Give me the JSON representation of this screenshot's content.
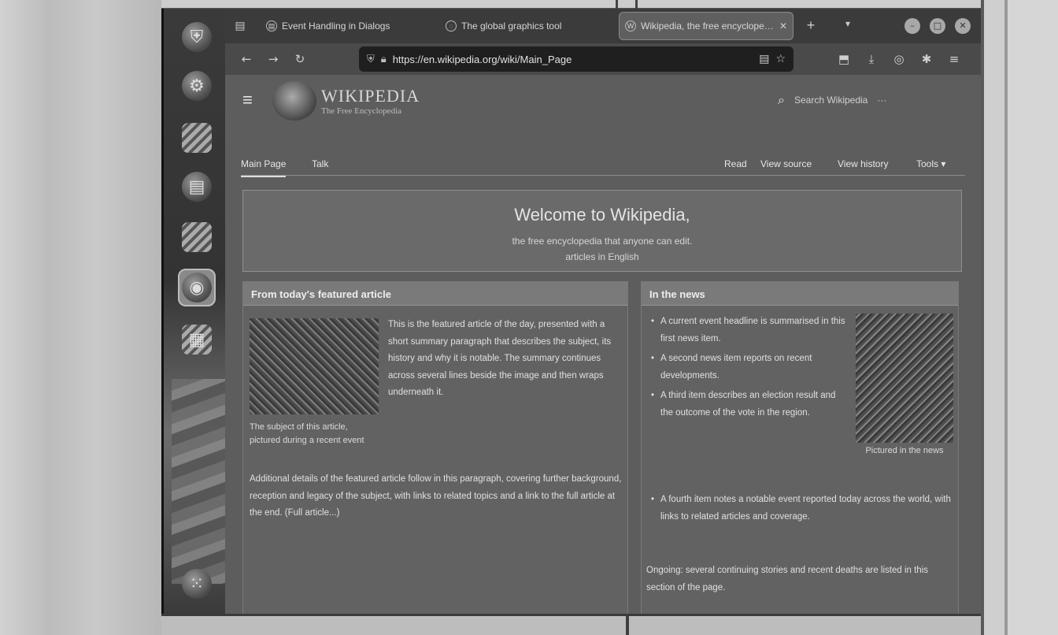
{
  "browser": {
    "tabs": [
      {
        "title": "Event Handling in Dialogs",
        "favicon_icon": "document-icon",
        "active": false
      },
      {
        "title": "The global graphics tool",
        "favicon_icon": "globe-icon",
        "active": false
      },
      {
        "title": "Wikipedia, the free encyclopedia",
        "favicon_icon": "wikipedia-icon",
        "active": true
      }
    ],
    "url": "https://en.wikipedia.org/wiki/Main_Page"
  },
  "wikipedia": {
    "wordmark": "WIKIPEDIA",
    "tagline": "The Free Encyclopedia",
    "search_placeholder": "Search Wikipedia",
    "page_tabs": {
      "main_page": "Main Page",
      "talk": "Talk",
      "read": "Read",
      "view_source": "View source",
      "view_history": "View history",
      "tools": "Tools ▾"
    },
    "welcome": {
      "title": "Welcome to Wikipedia,",
      "line1": "the free encyclopedia that anyone can edit.",
      "line2": "articles in English"
    },
    "featured": {
      "heading": "From today's featured article",
      "caption": "The subject of this article, pictured during a recent event",
      "text": "This is the featured article of the day, presented with a short summary paragraph that describes the subject, its history and why it is notable. The summary continues across several lines beside the image and then wraps underneath it.",
      "more": "Additional details of the featured article follow in this paragraph, covering further background, reception and legacy of the subject, with links to related topics and a link to the full article at the end. (Full article...)"
    },
    "news": {
      "heading": "In the news",
      "caption": "Pictured in the news",
      "items": [
        "A current event headline is summarised in this first news item.",
        "A second news item reports on recent developments.",
        "A third item describes an election result and the outcome of the vote in the region."
      ],
      "items2": [
        "A fourth item notes a notable event reported today across the world, with links to related articles and coverage."
      ],
      "more": "Ongoing: several continuing stories and recent deaths are listed in this section of the page."
    }
  }
}
